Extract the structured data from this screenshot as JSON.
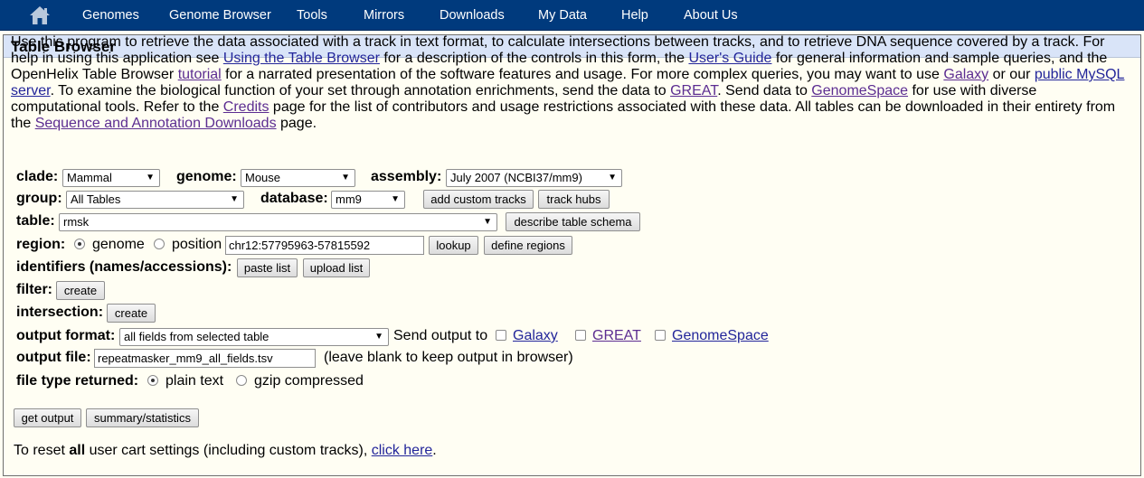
{
  "nav": {
    "home_icon": "home-icon",
    "items": [
      "Genomes",
      "Genome Browser",
      "Tools",
      "Mirrors",
      "Downloads",
      "My Data",
      "Help",
      "About Us"
    ]
  },
  "panel": {
    "title": "Table Browser"
  },
  "intro": {
    "t1": "Use this program to retrieve the data associated with a track in text format, to calculate intersections between tracks, and to retrieve DNA sequence covered by a track. For help in using this application see ",
    "link_using": "Using the Table Browser",
    "t2": " for a description of the controls in this form, the ",
    "link_guide": "User's Guide",
    "t3": " for general information and sample queries, and the OpenHelix Table Browser ",
    "link_tutorial": "tutorial",
    "t4": " for a narrated presentation of the software features and usage. For more complex queries, you may want to use ",
    "link_galaxy": "Galaxy",
    "t5": " or our ",
    "link_mysql": "public MySQL server",
    "t6": ". To examine the biological function of your set through annotation enrichments, send the data to ",
    "link_great": "GREAT",
    "t7": ". Send data to ",
    "link_genomespace": "GenomeSpace",
    "t8": " for use with diverse computational tools. Refer to the ",
    "link_credits": "Credits",
    "t9": " page for the list of contributors and usage restrictions associated with these data. All tables can be downloaded in their entirety from the ",
    "link_downloads": "Sequence and Annotation Downloads",
    "t10": " page."
  },
  "form": {
    "clade_label": "clade:",
    "clade_value": "Mammal",
    "genome_label": "genome:",
    "genome_value": "Mouse",
    "assembly_label": "assembly:",
    "assembly_value": "July 2007 (NCBI37/mm9)",
    "group_label": "group:",
    "group_value": "All Tables",
    "database_label": "database:",
    "database_value": "mm9",
    "add_custom_tracks": "add custom tracks",
    "track_hubs": "track hubs",
    "table_label": "table:",
    "table_value": "rmsk",
    "describe_schema": "describe table schema",
    "region_label": "region:",
    "region_genome": "genome",
    "region_position": "position",
    "position_value": "chr12:57795963-57815592",
    "region_selected": "genome",
    "lookup": "lookup",
    "define_regions": "define regions",
    "identifiers_label": "identifiers (names/accessions):",
    "paste_list": "paste list",
    "upload_list": "upload list",
    "filter_label": "filter:",
    "filter_create": "create",
    "intersection_label": "intersection:",
    "intersection_create": "create",
    "output_format_label": "output format:",
    "output_format_value": "all fields from selected table",
    "send_output_to": "Send output to",
    "send_galaxy": "Galaxy",
    "send_great": "GREAT",
    "send_genomespace": "GenomeSpace",
    "output_file_label": "output file:",
    "output_file_value": "repeatmasker_mm9_all_fields.tsv",
    "output_file_hint": "(leave blank to keep output in browser)",
    "file_type_label": "file type returned:",
    "file_type_plain": "plain text",
    "file_type_gzip": "gzip compressed",
    "file_type_selected": "plain text",
    "get_output": "get output",
    "summary_stats": "summary/statistics"
  },
  "reset": {
    "t1": "To reset ",
    "bold": "all",
    "t2": " user cart settings (including custom tracks), ",
    "link": "click here",
    "t3": "."
  },
  "colors": {
    "navbar_bg": "#003A7D",
    "page_bg": "#FFFEF3",
    "header_bg": "#D9E4F8",
    "link": "#22259A",
    "visited_link": "#5C2D91"
  }
}
